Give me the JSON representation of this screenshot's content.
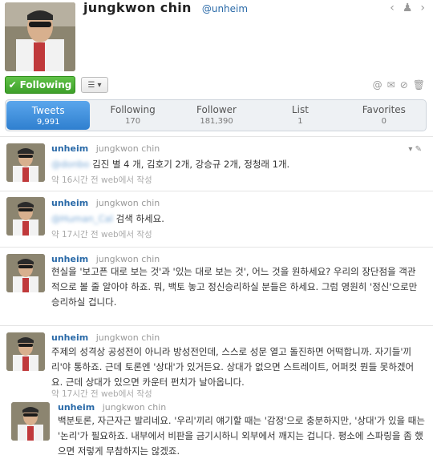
{
  "profile": {
    "full_name": "jungkwon chin",
    "handle": "@unheim",
    "follow_label": "Following"
  },
  "stats": [
    {
      "label": "Tweets",
      "value": "9,991"
    },
    {
      "label": "Following",
      "value": "170"
    },
    {
      "label": "Follower",
      "value": "181,390"
    },
    {
      "label": "List",
      "value": "1"
    },
    {
      "label": "Favorites",
      "value": "0"
    }
  ],
  "tweets": [
    {
      "user": "unheim",
      "name": "jungkwon chin",
      "mention": "@donbo",
      "text": "김진 별 4 개, 김호기 2개, 강승규 2개, 정청래 1개.",
      "meta": "약 16시간 전 web에서 작성"
    },
    {
      "user": "unheim",
      "name": "jungkwon chin",
      "mention": "@Human_Cal",
      "text": "검색 하세요.",
      "meta": "약 17시간 전 web에서 작성"
    },
    {
      "user": "unheim",
      "name": "jungkwon chin",
      "text": "현실을 '보고픈 대로 보는 것'과 '있는 대로 보는 것', 어느 것을 원하세요? 우리의 장단점을 객관적으로 볼 줄 알아야 하죠. 뭐, 백토 놓고 정신승리하실 분들은 하세요. 그럼 영원히 '정신'으로만 승리하실 겁니다.",
      "meta": "약 17시간 전 web에서 작성"
    },
    {
      "user": "unheim",
      "name": "jungkwon chin",
      "text": "주제의 성격상 공성전이 아니라 방성전인데, 스스로 성문 열고 돌진하면 어떡합니까. 자기들'끼리'야 통하죠. 근데 토론엔 '상대'가 있거든요. 상대가 없으면 스트레이트, 어퍼컷 뭔들 못하겠어요. 근데 상대가 있으면 카운터 펀치가 날아옵니다.",
      "meta": "약 17시간 전 web에서 작성"
    },
    {
      "user": "unheim",
      "name": "jungkwon chin",
      "text": "백분토론, 자근자근 발리네요. '우리'끼리 얘기할 때는 '감정'으로 충분하지만, '상대'가 있을 때는 '논리'가 필요하죠. 내부에서 비판을 금기시하니 외부에서 깨지는 겁니다. 평소에 스파링을 좀 했으면 저렇게 무참하지는 않겠죠.",
      "meta": ""
    }
  ]
}
